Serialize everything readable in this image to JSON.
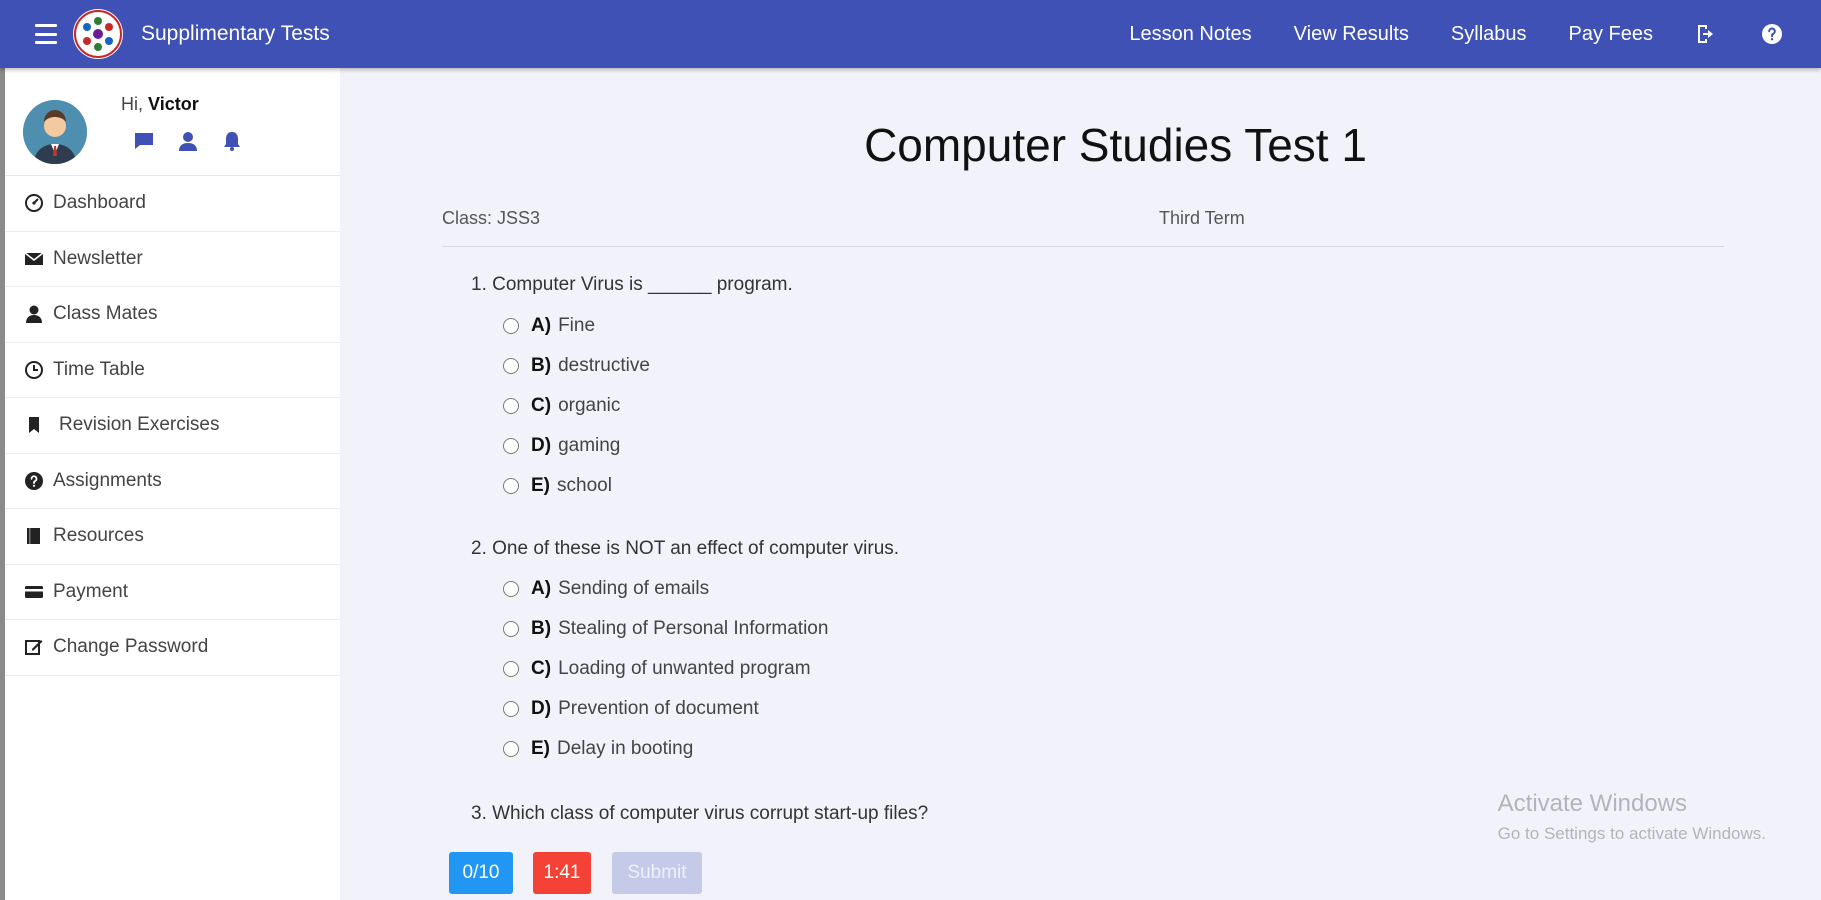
{
  "header": {
    "app_title": "Supplimentary Tests",
    "nav": [
      "Lesson Notes",
      "View Results",
      "Syllabus",
      "Pay Fees"
    ],
    "icons": [
      "menu-icon",
      "logout-icon",
      "help-icon"
    ],
    "color": "#3f51b5"
  },
  "sidebar": {
    "greeting_prefix": "Hi,",
    "user_name": "Victor",
    "profile_icons": [
      "message-icon",
      "person-icon",
      "bell-icon"
    ],
    "items": [
      {
        "label": "Dashboard",
        "icon": "dashboard-icon"
      },
      {
        "label": "Newsletter",
        "icon": "envelope-icon"
      },
      {
        "label": "Class Mates",
        "icon": "person-icon"
      },
      {
        "label": "Time Table",
        "icon": "clock-icon"
      },
      {
        "label": "Revision Exercises",
        "icon": "bookmark-icon"
      },
      {
        "label": "Assignments",
        "icon": "question-icon"
      },
      {
        "label": "Resources",
        "icon": "book-icon"
      },
      {
        "label": "Payment",
        "icon": "card-icon"
      },
      {
        "label": "Change Password",
        "icon": "edit-icon"
      }
    ]
  },
  "test": {
    "title": "Computer Studies Test 1",
    "class_label": "Class: JSS3",
    "term": "Third Term",
    "questions": [
      {
        "text": "1. Computer Virus is ______ program.",
        "options": [
          {
            "letter": "A)",
            "text": "Fine"
          },
          {
            "letter": "B)",
            "text": "destructive"
          },
          {
            "letter": "C)",
            "text": "organic"
          },
          {
            "letter": "D)",
            "text": "gaming"
          },
          {
            "letter": "E)",
            "text": "school"
          }
        ]
      },
      {
        "text": "2. One of these is NOT an effect of computer virus.",
        "options": [
          {
            "letter": "A)",
            "text": "Sending of emails"
          },
          {
            "letter": "B)",
            "text": "Stealing of Personal Information"
          },
          {
            "letter": "C)",
            "text": "Loading of unwanted program"
          },
          {
            "letter": "D)",
            "text": "Prevention of document"
          },
          {
            "letter": "E)",
            "text": "Delay in booting"
          }
        ]
      },
      {
        "text": "3. Which class of computer virus corrupt start-up files?",
        "options": []
      }
    ]
  },
  "footer": {
    "score": "0/10",
    "timer": "1:41",
    "submit_label": "Submit",
    "colors": {
      "score": "#2196f3",
      "timer": "#f44336",
      "submit": "#c5cae9"
    }
  },
  "watermark": {
    "line1": "Activate Windows",
    "line2": "Go to Settings to activate Windows."
  }
}
